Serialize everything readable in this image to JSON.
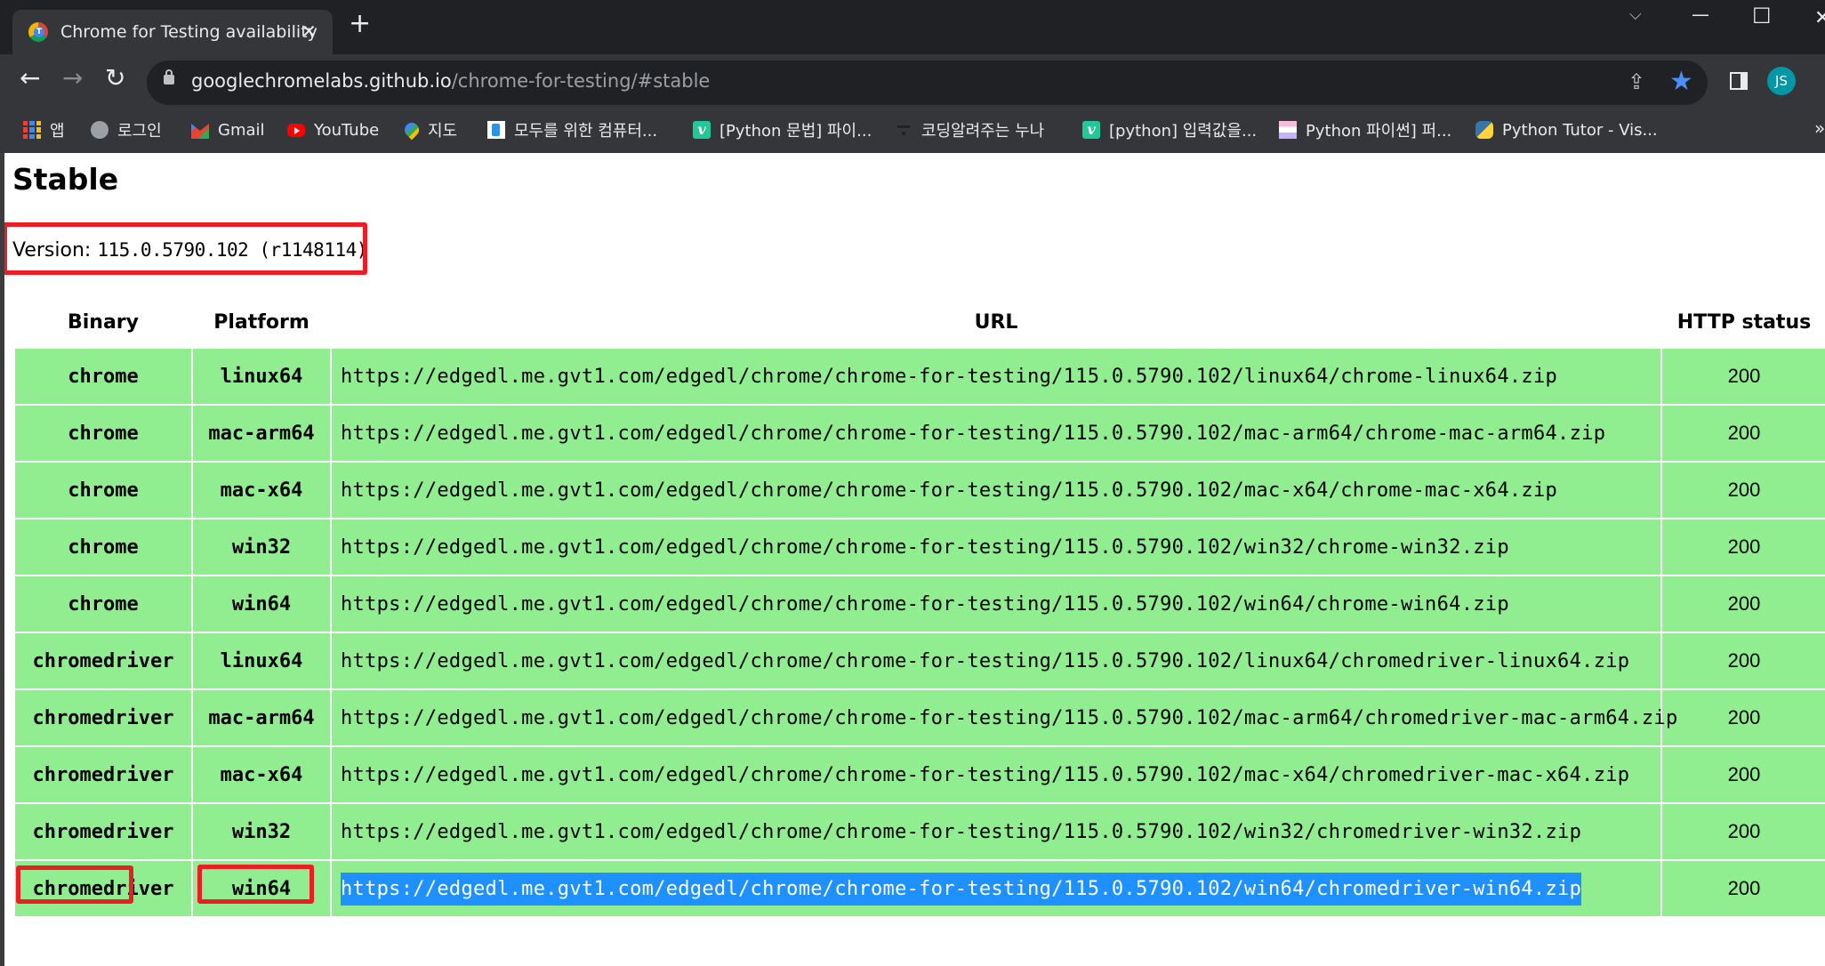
{
  "browser": {
    "tab": {
      "title": "Chrome for Testing availability",
      "favicon": "chrome-for-testing-icon"
    },
    "new_tab_label": "+",
    "window_controls": {
      "tab_search": "⌵",
      "minimize": "—",
      "maximize": "☐",
      "close": "✕"
    },
    "nav": {
      "back": "←",
      "forward": "→",
      "reload": "↻"
    },
    "address": {
      "host": "googlechromelabs.github.io",
      "path": "/chrome-for-testing/#stable"
    },
    "omnibox_icons": {
      "share": "⇪",
      "bookmark_star": "★"
    },
    "profile_initials": "JS",
    "menu": "⋮"
  },
  "bookmarks": [
    {
      "label": "앱",
      "icon": "apps-grid-icon"
    },
    {
      "label": "로그인",
      "icon": "globe-icon"
    },
    {
      "label": "Gmail",
      "icon": "gmail-icon"
    },
    {
      "label": "YouTube",
      "icon": "youtube-icon"
    },
    {
      "label": "지도",
      "icon": "maps-pin-icon"
    },
    {
      "label": "모두를 위한 컴퓨터...",
      "icon": "book-icon"
    },
    {
      "label": "[Python 문법] 파이...",
      "icon": "velog-icon",
      "icon_text": "v"
    },
    {
      "label": "코딩알려주는 누나",
      "icon": "dash-icon"
    },
    {
      "label": "[python] 입력값을...",
      "icon": "velog-icon",
      "icon_text": "v"
    },
    {
      "label": "Python 파이썬] 퍼...",
      "icon": "stripes-icon"
    },
    {
      "label": "Python Tutor - Vis...",
      "icon": "python-icon"
    }
  ],
  "bookmarks_overflow": "»",
  "page": {
    "heading": "Stable",
    "version_label": "Version:",
    "version_value": "115.0.5790.102 (r1148114)",
    "table": {
      "headers": [
        "Binary",
        "Platform",
        "URL",
        "HTTP status"
      ],
      "rows": [
        {
          "binary": "chrome",
          "platform": "linux64",
          "url": "https://edgedl.me.gvt1.com/edgedl/chrome/chrome-for-testing/115.0.5790.102/linux64/chrome-linux64.zip",
          "status": "200"
        },
        {
          "binary": "chrome",
          "platform": "mac-arm64",
          "url": "https://edgedl.me.gvt1.com/edgedl/chrome/chrome-for-testing/115.0.5790.102/mac-arm64/chrome-mac-arm64.zip",
          "status": "200"
        },
        {
          "binary": "chrome",
          "platform": "mac-x64",
          "url": "https://edgedl.me.gvt1.com/edgedl/chrome/chrome-for-testing/115.0.5790.102/mac-x64/chrome-mac-x64.zip",
          "status": "200"
        },
        {
          "binary": "chrome",
          "platform": "win32",
          "url": "https://edgedl.me.gvt1.com/edgedl/chrome/chrome-for-testing/115.0.5790.102/win32/chrome-win32.zip",
          "status": "200"
        },
        {
          "binary": "chrome",
          "platform": "win64",
          "url": "https://edgedl.me.gvt1.com/edgedl/chrome/chrome-for-testing/115.0.5790.102/win64/chrome-win64.zip",
          "status": "200"
        },
        {
          "binary": "chromedriver",
          "platform": "linux64",
          "url": "https://edgedl.me.gvt1.com/edgedl/chrome/chrome-for-testing/115.0.5790.102/linux64/chromedriver-linux64.zip",
          "status": "200"
        },
        {
          "binary": "chromedriver",
          "platform": "mac-arm64",
          "url": "https://edgedl.me.gvt1.com/edgedl/chrome/chrome-for-testing/115.0.5790.102/mac-arm64/chromedriver-mac-arm64.zip",
          "status": "200"
        },
        {
          "binary": "chromedriver",
          "platform": "mac-x64",
          "url": "https://edgedl.me.gvt1.com/edgedl/chrome/chrome-for-testing/115.0.5790.102/mac-x64/chromedriver-mac-x64.zip",
          "status": "200"
        },
        {
          "binary": "chromedriver",
          "platform": "win32",
          "url": "https://edgedl.me.gvt1.com/edgedl/chrome/chrome-for-testing/115.0.5790.102/win32/chromedriver-win32.zip",
          "status": "200"
        },
        {
          "binary": "chromedriver",
          "platform": "win64",
          "url": "https://edgedl.me.gvt1.com/edgedl/chrome/chrome-for-testing/115.0.5790.102/win64/chromedriver-win64.zip",
          "status": "200",
          "url_selected": true,
          "highlighted": true
        }
      ]
    }
  },
  "colors": {
    "row_bg": "#90ee90",
    "selection": "#1e90ff",
    "annotation": "#ee1c25",
    "avatar": "#0097a7",
    "star": "#4b8ef8"
  }
}
